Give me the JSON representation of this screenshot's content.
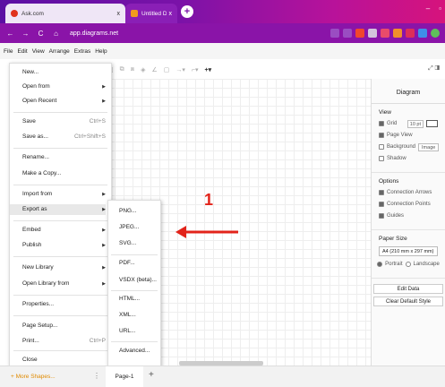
{
  "browser": {
    "tabs": [
      {
        "label": "Ask.com",
        "close": "x"
      },
      {
        "label": "Untitled Diagram - diagrams.net",
        "close": "x"
      }
    ],
    "new_tab": "+",
    "url": "app.diagrams.net",
    "nav": {
      "back": "←",
      "forward": "→",
      "reload": "C",
      "home": "⌂"
    },
    "window_controls": {
      "minimize": "–",
      "restore": "▫"
    }
  },
  "menubar": {
    "items": [
      "File",
      "Edit",
      "View",
      "Arrange",
      "Extras",
      "Help"
    ]
  },
  "toolbar": {
    "right_label": "⤢ ◨"
  },
  "file_menu": {
    "items": [
      {
        "label": "New...",
        "shortcut": ""
      },
      {
        "label": "Open from",
        "submenu": "▶"
      },
      {
        "label": "Open Recent",
        "submenu": "▶"
      },
      {
        "label": "Save",
        "shortcut": "Ctrl+S"
      },
      {
        "label": "Save as...",
        "shortcut": "Ctrl+Shift+S"
      },
      {
        "label": "Rename..."
      },
      {
        "label": "Make a Copy..."
      },
      {
        "label": "Import from",
        "submenu": "▶"
      },
      {
        "label": "Export as",
        "submenu": "▶"
      },
      {
        "label": "Embed",
        "submenu": "▶"
      },
      {
        "label": "Publish",
        "submenu": "▶"
      },
      {
        "label": "New Library",
        "submenu": "▶"
      },
      {
        "label": "Open Library from",
        "submenu": "▶"
      },
      {
        "label": "Properties..."
      },
      {
        "label": "Page Setup..."
      },
      {
        "label": "Print...",
        "shortcut": "Ctrl+P"
      },
      {
        "label": "Close"
      }
    ]
  },
  "export_menu": {
    "items": [
      "PNG...",
      "JPEG...",
      "SVG...",
      "PDF...",
      "VSDX (beta)...",
      "HTML...",
      "XML...",
      "URL...",
      "Advanced..."
    ]
  },
  "annotation": {
    "number": "1",
    "color": "#e2231a"
  },
  "format_panel": {
    "title": "Diagram",
    "view": {
      "heading": "View",
      "grid_label": "Grid",
      "grid_size": "10 pt",
      "page_view_label": "Page View",
      "background_label": "Background",
      "image_button": "Image",
      "shadow_label": "Shadow"
    },
    "options": {
      "heading": "Options",
      "connection_arrows": "Connection Arrows",
      "connection_points": "Connection Points",
      "guides": "Guides"
    },
    "paper": {
      "heading": "Paper Size",
      "size": "A4 (210 mm x 297 mm)",
      "portrait": "Portrait",
      "landscape": "Landscape"
    },
    "edit_data_button": "Edit Data",
    "clear_style_button": "Clear Default Style"
  },
  "bottombar": {
    "more_shapes": "+ More Shapes...",
    "pages_menu": "⋮",
    "page_tab": "Page-1",
    "add_page": "+"
  },
  "colors": {
    "brand_gradient_start": "#5b0fa3",
    "brand_gradient_end": "#d6137c",
    "annotation_red": "#e2231a",
    "more_shapes_orange": "#e08a00"
  }
}
